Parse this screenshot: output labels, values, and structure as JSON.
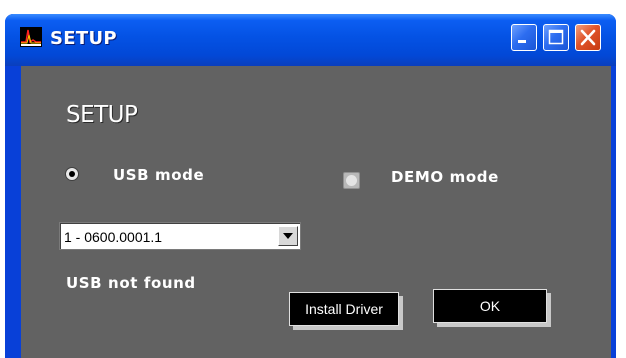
{
  "window": {
    "title": "SETUP",
    "app_icon": "waveform-app-icon",
    "controls": {
      "minimize": "minimize-icon",
      "maximize": "maximize-icon",
      "close": "close-icon"
    }
  },
  "setup": {
    "heading": "SETUP",
    "mode_options": {
      "usb_label": "USB mode",
      "demo_label": "DEMO mode",
      "selected": "USB mode"
    },
    "device_select": {
      "value": "1 - 0600.0001.1"
    },
    "status_text": "USB not found",
    "install_driver_label": "Install Driver",
    "ok_label": "OK"
  },
  "colors": {
    "titlebar": "#0452e4",
    "client_background": "#626262",
    "close_button": "#e0542a",
    "button_background": "#000000"
  }
}
